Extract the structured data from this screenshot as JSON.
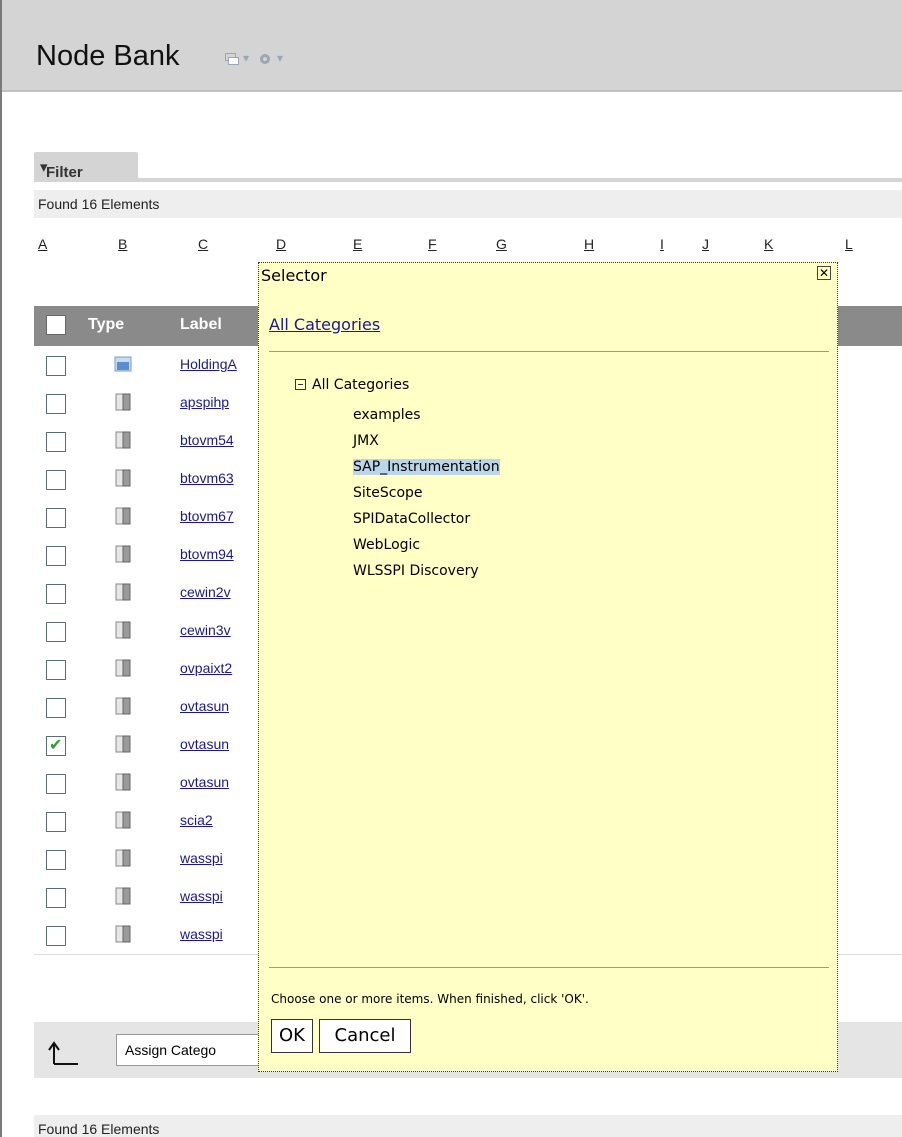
{
  "header": {
    "title": "Node Bank"
  },
  "filter": {
    "label": "Filter"
  },
  "found_text": "Found 16 Elements",
  "alphabet": [
    "A",
    "B",
    "C",
    "D",
    "E",
    "F",
    "G",
    "H",
    "I",
    "J",
    "K",
    "L"
  ],
  "table": {
    "headers": {
      "type": "Type",
      "label": "Label"
    },
    "rows": [
      {
        "label": "HoldingA",
        "type": "folder",
        "checked": false
      },
      {
        "label": "apspihp",
        "type": "node",
        "checked": false
      },
      {
        "label": "btovm54",
        "type": "node",
        "checked": false
      },
      {
        "label": "btovm63",
        "type": "node",
        "checked": false
      },
      {
        "label": "btovm67",
        "type": "node",
        "checked": false
      },
      {
        "label": "btovm94",
        "type": "node",
        "checked": false
      },
      {
        "label": "cewin2v",
        "type": "node",
        "checked": false
      },
      {
        "label": "cewin3v",
        "type": "node",
        "checked": false
      },
      {
        "label": "ovpaixt2",
        "type": "node",
        "checked": false
      },
      {
        "label": "ovtasun",
        "type": "node",
        "checked": false
      },
      {
        "label": "ovtasun",
        "type": "node",
        "checked": true
      },
      {
        "label": "ovtasun",
        "type": "node",
        "checked": false
      },
      {
        "label": "scia2",
        "type": "node",
        "checked": false
      },
      {
        "label": "wasspi",
        "type": "node",
        "checked": false
      },
      {
        "label": "wasspi",
        "type": "node",
        "checked": false
      },
      {
        "label": "wasspi",
        "type": "node",
        "checked": false
      }
    ]
  },
  "action": {
    "assign_label": "Assign Catego"
  },
  "selector": {
    "title": "Selector",
    "breadcrumb": "All Categories",
    "root": "All Categories",
    "items": [
      "examples",
      "JMX",
      "SAP_Instrumentation",
      "SiteScope",
      "SPIDataCollector",
      "WebLogic",
      "WLSSPI Discovery"
    ],
    "selected_item": "SAP_Instrumentation",
    "instructions": "Choose one or more items. When finished, click 'OK'.",
    "ok_label": "OK",
    "cancel_label": "Cancel"
  },
  "colors": {
    "header_bg": "#d4d4d4",
    "selector_bg": "#ffffc6",
    "table_header_bg": "#8a8a8a",
    "link": "#1a1a8c",
    "selected_bg": "#bad6e8"
  }
}
